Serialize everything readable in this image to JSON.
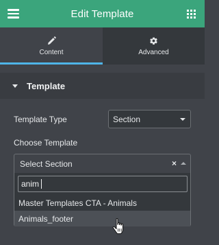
{
  "header": {
    "title": "Edit Template",
    "menu_icon": "hamburger-menu-icon",
    "apps_icon": "apps-grid-icon"
  },
  "tabs": [
    {
      "label": "Content",
      "icon": "pencil-icon",
      "active": true
    },
    {
      "label": "Advanced",
      "icon": "gear-icon",
      "active": false
    }
  ],
  "section": {
    "title": "Template",
    "expanded": true
  },
  "template_type": {
    "label": "Template Type",
    "value": "Section"
  },
  "choose_template": {
    "label": "Choose Template",
    "value": "Select Section",
    "clear_label": "×",
    "search_value": "anim",
    "options": [
      "Master Templates CTA - Animals",
      "Animals_footer"
    ],
    "highlighted_index": 1
  },
  "colors": {
    "header_bg": "#3ba57c",
    "panel_bg": "#404349",
    "active_tab_indicator": "#4fb5e8"
  }
}
